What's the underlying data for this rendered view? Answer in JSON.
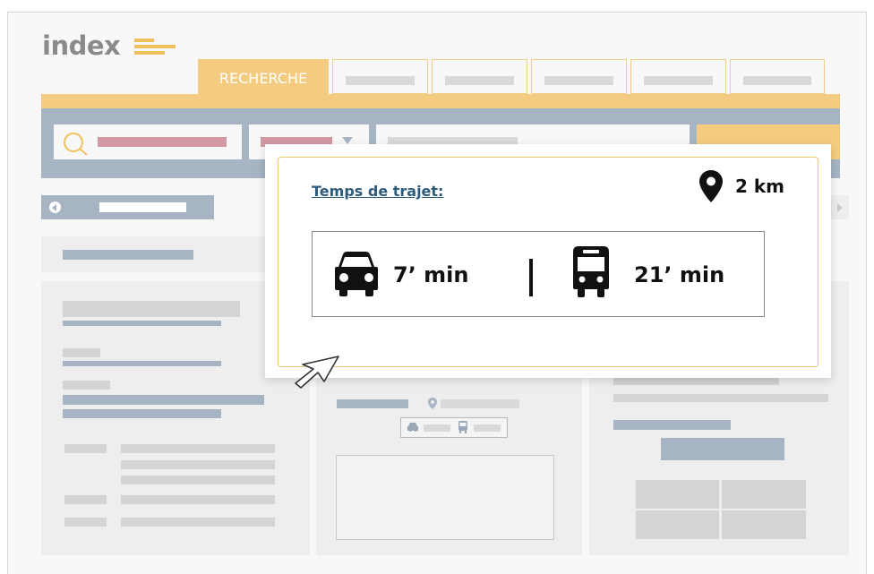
{
  "logo": {
    "text": "index"
  },
  "tabs": [
    {
      "label": "RECHERCHE",
      "active": true
    },
    {
      "label": ""
    },
    {
      "label": ""
    },
    {
      "label": ""
    },
    {
      "label": ""
    },
    {
      "label": ""
    }
  ],
  "popup": {
    "travel_label": "Temps de trajet:",
    "distance": "2 km",
    "car_time": "7’ min",
    "bus_time": "21’ min"
  },
  "icons": {
    "search": "search-icon",
    "location": "location-pin-icon",
    "car": "car-icon",
    "bus": "bus-icon",
    "cursor": "mouse-pointer-icon"
  },
  "colors": {
    "accent_orange": "#f4cc81",
    "logo_bar": "#f2c05c",
    "steel_blue": "#a6b4c4",
    "pink": "#d398a2",
    "link_blue": "#2d5b7c"
  }
}
